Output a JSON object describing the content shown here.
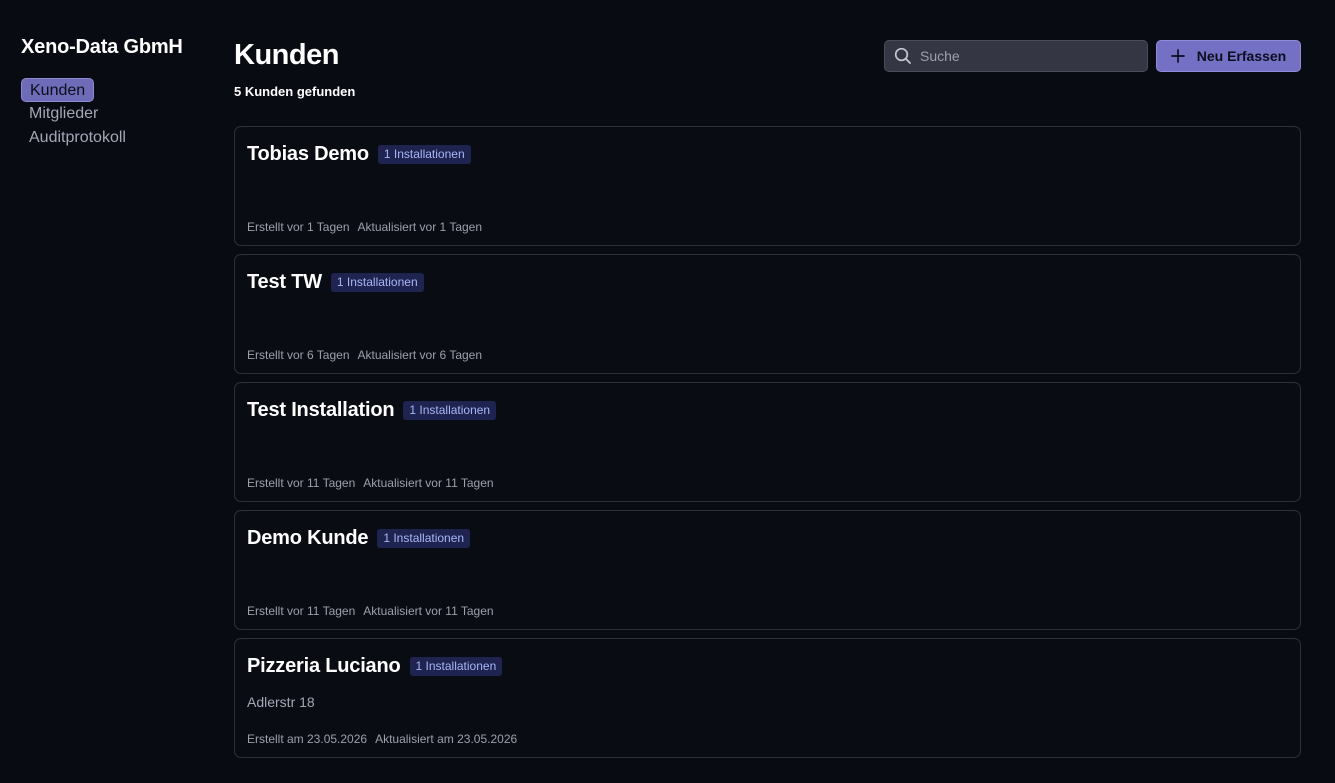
{
  "sidebar": {
    "org_name": "Xeno-Data GbmH",
    "items": [
      {
        "label": "Kunden",
        "active": true
      },
      {
        "label": "Mitglieder",
        "active": false
      },
      {
        "label": "Auditprotokoll",
        "active": false
      }
    ]
  },
  "header": {
    "title": "Kunden",
    "count_text": "5 Kunden gefunden",
    "search_placeholder": "Suche",
    "search_value": "",
    "add_button_label": "Neu Erfassen",
    "search_icon": "search-icon",
    "add_icon": "plus-icon"
  },
  "customers": [
    {
      "name": "Tobias Demo",
      "badge": "1 Installationen",
      "address": "",
      "created": "Erstellt vor 1 Tagen",
      "updated": "Aktualisiert vor 1 Tagen"
    },
    {
      "name": "Test TW",
      "badge": "1 Installationen",
      "address": "",
      "created": "Erstellt vor 6 Tagen",
      "updated": "Aktualisiert vor 6 Tagen"
    },
    {
      "name": "Test Installation",
      "badge": "1 Installationen",
      "address": "",
      "created": "Erstellt vor 11 Tagen",
      "updated": "Aktualisiert vor 11 Tagen"
    },
    {
      "name": "Demo Kunde",
      "badge": "1 Installationen",
      "address": "",
      "created": "Erstellt vor 11 Tagen",
      "updated": "Aktualisiert vor 11 Tagen"
    },
    {
      "name": "Pizzeria Luciano",
      "badge": "1 Installationen",
      "address": "Adlerstr 18",
      "created": "Erstellt am 23.05.2026",
      "updated": "Aktualisiert am 23.05.2026"
    }
  ],
  "colors": {
    "background": "#090b13",
    "accent": "#7471c4",
    "badge_bg": "#1e2350",
    "badge_text": "#a9b6f5"
  }
}
